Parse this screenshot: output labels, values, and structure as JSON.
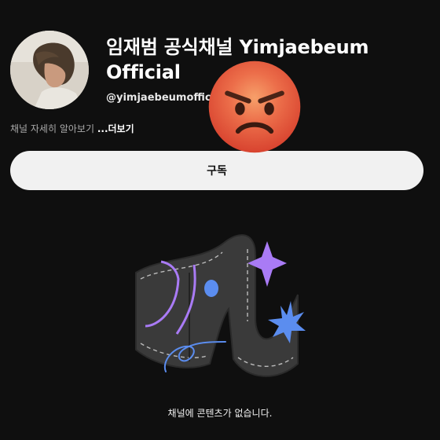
{
  "channel": {
    "title": "임재범 공식채널 Yimjaebeum Official",
    "handle": "@yimjaebeumofficial",
    "about_text": "채널 자세히 알아보기",
    "more_label": "...더보기"
  },
  "subscribe_label": "구독",
  "empty_message": "채널에 콘텐츠가 없습니다.",
  "colors": {
    "background": "#0f0f0f",
    "subscribe_bg": "#f1f1f1",
    "accent_purple": "#a97bf5",
    "accent_blue": "#5b8def",
    "emoji_red": "#e5533a"
  },
  "icons": [
    "avatar-photo",
    "angry-face-emoji",
    "empty-channel-illustration"
  ]
}
